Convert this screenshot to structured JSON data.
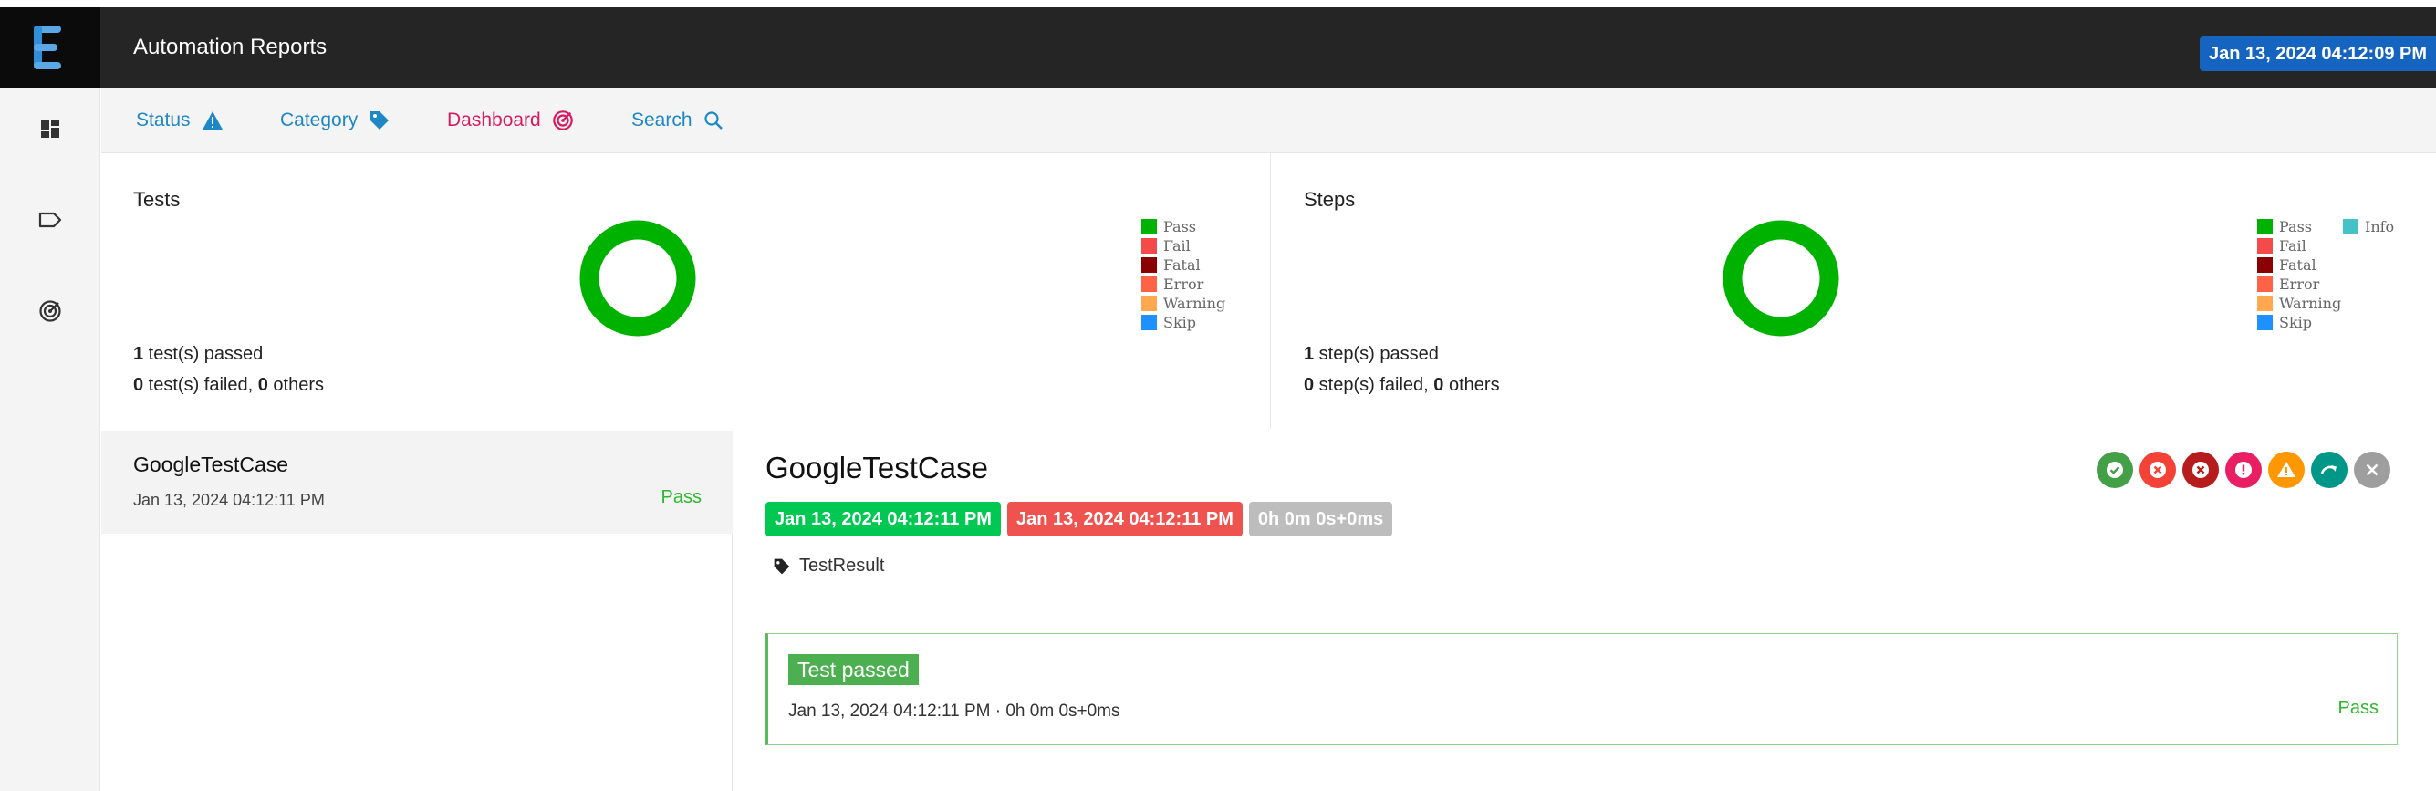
{
  "header": {
    "title": "Automation Reports",
    "timestamp": "Jan 13, 2024 04:12:09 PM",
    "accent_color": "#1565c0"
  },
  "sidebar": {
    "items": [
      {
        "icon": "dashboard-icon"
      },
      {
        "icon": "tag-outline-icon"
      },
      {
        "icon": "target-icon"
      }
    ]
  },
  "nav": {
    "items": [
      {
        "label": "Status",
        "icon": "warning-icon"
      },
      {
        "label": "Category",
        "icon": "tag-icon"
      },
      {
        "label": "Dashboard",
        "icon": "target-icon"
      },
      {
        "label": "Search",
        "icon": "search-icon"
      }
    ]
  },
  "tests_card": {
    "title": "Tests",
    "passed_count": "1",
    "passed_text": " test(s) passed",
    "failed_count": "0",
    "failed_text": " test(s) failed, ",
    "others_count": "0",
    "others_text": " others",
    "legend": [
      "Pass",
      "Fail",
      "Fatal",
      "Error",
      "Warning",
      "Skip"
    ]
  },
  "steps_card": {
    "title": "Steps",
    "passed_count": "1",
    "passed_text": " step(s) passed",
    "failed_count": "0",
    "failed_text": " step(s) failed, ",
    "others_count": "0",
    "others_text": " others",
    "legend": [
      "Pass",
      "Fail",
      "Fatal",
      "Error",
      "Warning",
      "Skip"
    ],
    "legend_extra": "Info"
  },
  "legend_colors": {
    "Pass": "#00b200",
    "Fail": "#f44a4a",
    "Fatal": "#8b0000",
    "Error": "#ff6347",
    "Warning": "#ffa850",
    "Skip": "#1e90ff",
    "Info": "#47c1c8"
  },
  "test_list": [
    {
      "name": "GoogleTestCase",
      "time": "Jan 13, 2024 04:12:11 PM",
      "status": "Pass"
    }
  ],
  "detail": {
    "title": "GoogleTestCase",
    "start_time": "Jan 13, 2024 04:12:11 PM",
    "end_time": "Jan 13, 2024 04:12:11 PM",
    "duration": "0h 0m 0s+0ms",
    "tag": "TestResult",
    "log": {
      "label": "Test passed",
      "time": "Jan 13, 2024 04:12:11 PM · 0h 0m 0s+0ms",
      "status": "Pass"
    },
    "filter_icons": [
      "pass-filter-icon",
      "fail-filter-icon",
      "fatal-filter-icon",
      "error-filter-icon",
      "warning-filter-icon",
      "skip-filter-icon",
      "clear-filter-icon"
    ]
  }
}
